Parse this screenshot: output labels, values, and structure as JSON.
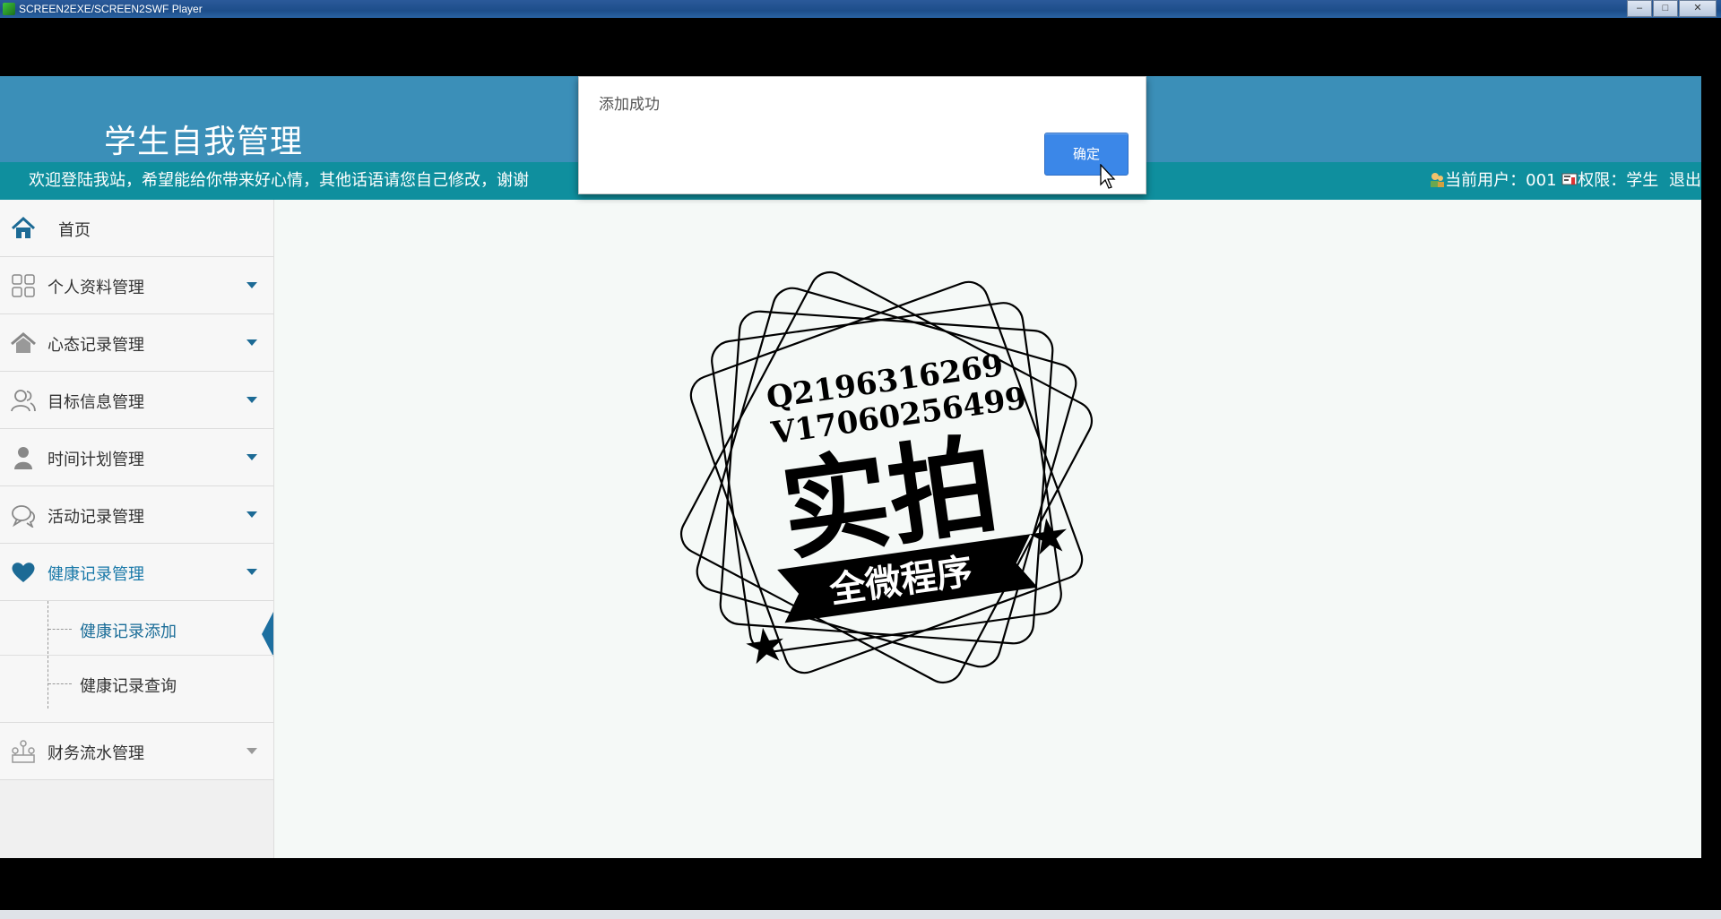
{
  "window": {
    "title": "SCREEN2EXE/SCREEN2SWF Player"
  },
  "header": {
    "app_title": "学生自我管理",
    "welcome": "欢迎登陆我站，希望能给你带来好心情，其他话语请您自己修改，谢谢",
    "current_user_label": "当前用户：001",
    "permission_label": "权限：学生",
    "logout": "退出"
  },
  "sidebar": {
    "items": [
      {
        "label": "首页",
        "icon": "home-icon"
      },
      {
        "label": "个人资料管理",
        "icon": "grid-icon"
      },
      {
        "label": "心态记录管理",
        "icon": "house-icon"
      },
      {
        "label": "目标信息管理",
        "icon": "users-icon"
      },
      {
        "label": "时间计划管理",
        "icon": "person-icon"
      },
      {
        "label": "活动记录管理",
        "icon": "chat-icon"
      },
      {
        "label": "健康记录管理",
        "icon": "heart-icon"
      },
      {
        "label": "财务流水管理",
        "icon": "org-icon"
      }
    ],
    "submenu": [
      {
        "label": "健康记录添加"
      },
      {
        "label": "健康记录查询"
      }
    ]
  },
  "stamp": {
    "line1": "Q2196316269",
    "line2": "V17060256499",
    "big": "实拍",
    "ribbon": "全微程序"
  },
  "dialog": {
    "message": "添加成功",
    "ok_label": "确定"
  },
  "colors": {
    "header": "#3b8fb8",
    "subbar": "#0f8f9e",
    "accent": "#3b87e8",
    "menu_active": "#1878a8"
  }
}
